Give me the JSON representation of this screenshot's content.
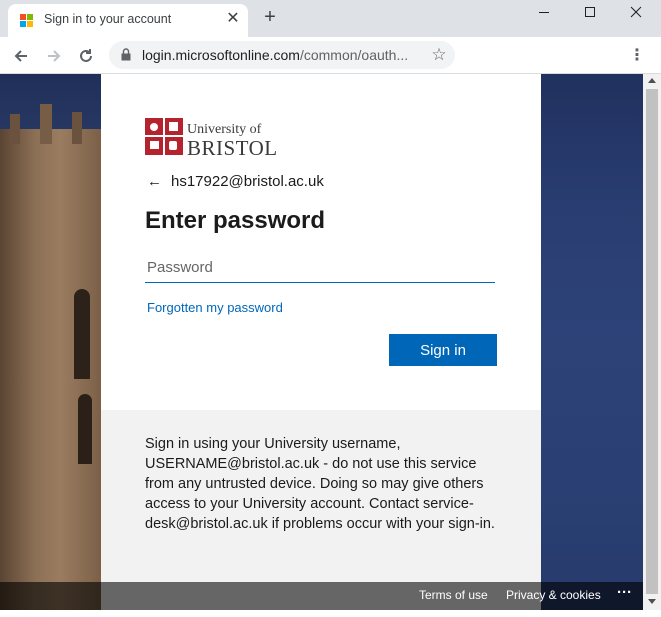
{
  "browser": {
    "tab_title": "Sign in to your account",
    "tab_close_icon": "close-icon",
    "new_tab_icon": "plus-icon",
    "url_host": "login.microsoftonline.com",
    "url_path": "/common/oauth...",
    "window_controls": [
      "minimize-icon",
      "maximize-icon",
      "close-icon"
    ]
  },
  "logo": {
    "line1": "University of",
    "line2": "BRISTOL"
  },
  "signin": {
    "identity": "hs17922@bristol.ac.uk",
    "title": "Enter password",
    "password_placeholder": "Password",
    "password_value": "",
    "forgot_link": "Forgotten my password",
    "button_label": "Sign in"
  },
  "info": {
    "text": "Sign in using your University username, USERNAME@bristol.ac.uk - do not use this service from any untrusted device. Doing so may give others access to your University account. Contact service-desk@bristol.ac.uk if problems occur with your sign-in."
  },
  "footer": {
    "terms": "Terms of use",
    "privacy": "Privacy & cookies",
    "more": "···"
  },
  "colors": {
    "accent": "#0067b8",
    "brand_red": "#b5232f"
  }
}
